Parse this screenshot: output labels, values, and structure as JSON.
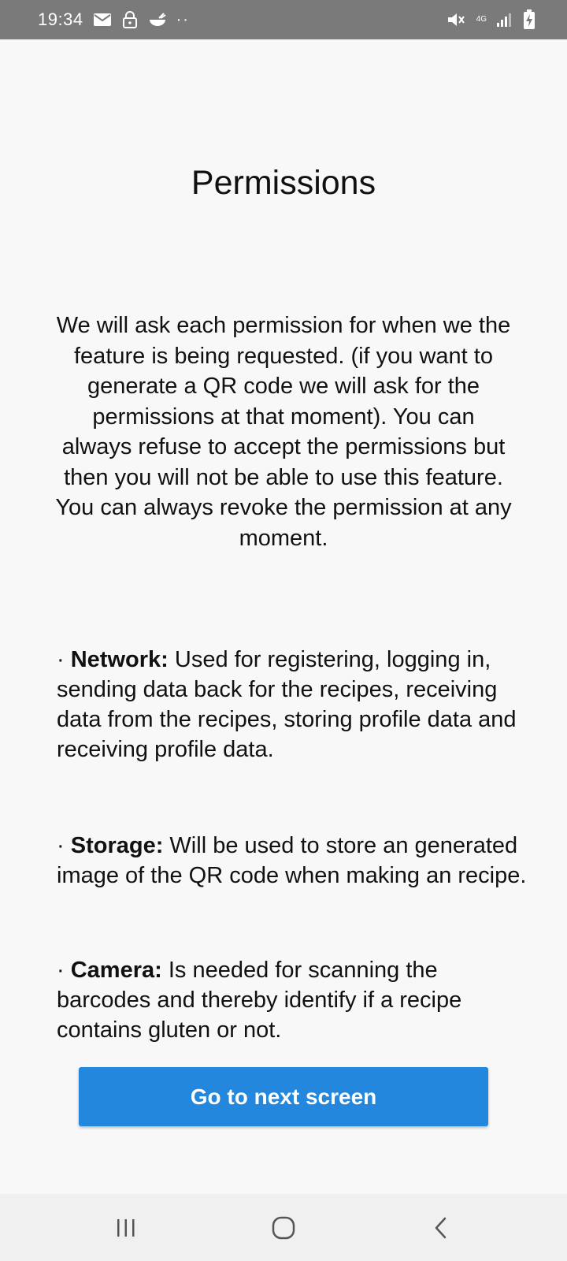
{
  "status_bar": {
    "time": "19:34",
    "network_type": "4G",
    "left_icons": [
      "mail-icon",
      "lock-icon",
      "food-bowl-icon",
      "more-dots-icon"
    ],
    "right_icons": [
      "mute-icon",
      "network-4g-icon",
      "signal-icon",
      "battery-charging-icon"
    ],
    "dots": "··"
  },
  "page": {
    "title": "Permissions",
    "intro": "We will ask each permission for when we the feature is being requested. (if you want to generate a QR code we will ask for the permissions at that moment). You can always refuse to accept the permissions but then you will not be able to use this feature. You can always revoke the permission at any moment."
  },
  "permissions": [
    {
      "bullet": "·",
      "name": "Network:",
      "description": " Used for registering, logging in, sending data back for the recipes, receiving data from the recipes, storing profile data and receiving profile data."
    },
    {
      "bullet": "·",
      "name": "Storage:",
      "description": " Will be used to store an generated image of the QR code when making an recipe."
    },
    {
      "bullet": "·",
      "name": "Camera:",
      "description": " Is needed for scanning the barcodes and thereby identify if a recipe contains gluten or not."
    }
  ],
  "next_button": {
    "label": "Go to next screen"
  },
  "nav_bar": {
    "buttons": [
      "recent-apps-icon",
      "home-icon",
      "back-icon"
    ]
  },
  "colors": {
    "accent": "#2387de",
    "status_bar": "#7a7a7a",
    "background": "#f8f8f8"
  }
}
